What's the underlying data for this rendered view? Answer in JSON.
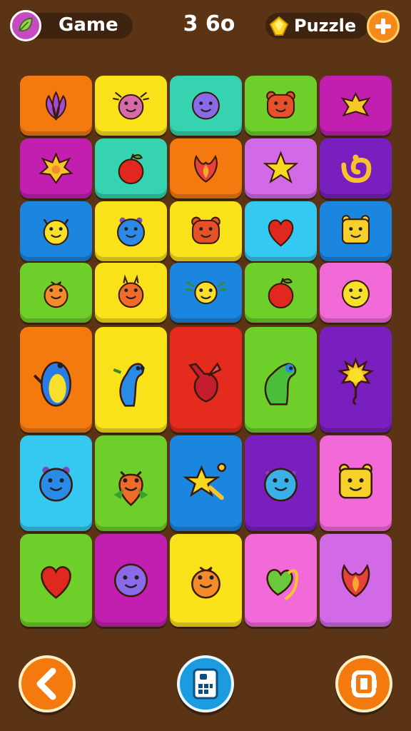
{
  "header": {
    "game_label": "Game",
    "score": "3 6o",
    "puzzle_label": "Puzzle"
  },
  "colors": {
    "background": "#5a3414",
    "orange": "#f47a10",
    "yellow": "#f9e21a",
    "teal": "#35d3b0",
    "green": "#6fcf2a",
    "magenta": "#c21fb0",
    "purple": "#7a1fbf",
    "blue": "#1b86e0",
    "cyan": "#35c8f0",
    "red": "#e52a1e",
    "pink": "#f26ad8",
    "lilac": "#d26ae8"
  },
  "board": {
    "rows": [
      [
        {
          "color": "orange",
          "icon": "lotus-icon"
        },
        {
          "color": "yellow",
          "icon": "bug-face-icon"
        },
        {
          "color": "teal",
          "icon": "purple-blob-icon"
        },
        {
          "color": "green",
          "icon": "bear-face-icon"
        },
        {
          "color": "magenta",
          "icon": "golden-bird-icon"
        }
      ],
      [
        {
          "color": "magenta",
          "icon": "sunflower-icon"
        },
        {
          "color": "teal",
          "icon": "apple-icon"
        },
        {
          "color": "orange",
          "icon": "flame-flower-icon"
        },
        {
          "color": "lilac",
          "icon": "star-icon"
        },
        {
          "color": "purple",
          "icon": "swirl-icon"
        }
      ],
      [
        {
          "color": "blue",
          "icon": "cat-face-icon"
        },
        {
          "color": "yellow",
          "icon": "blue-blob-icon"
        },
        {
          "color": "yellow",
          "icon": "bear-face-icon"
        },
        {
          "color": "cyan",
          "icon": "heart-icon"
        },
        {
          "color": "blue",
          "icon": "bear-square-icon"
        }
      ],
      [
        {
          "color": "green",
          "icon": "orange-fruit-icon"
        },
        {
          "color": "yellow",
          "icon": "horned-fruit-icon"
        },
        {
          "color": "blue",
          "icon": "winged-face-icon"
        },
        {
          "color": "green",
          "icon": "apple-icon"
        },
        {
          "color": "pink",
          "icon": "smiley-icon"
        }
      ],
      [
        {
          "color": "orange",
          "icon": "penguin-icon"
        },
        {
          "color": "yellow",
          "icon": "blue-worm-icon"
        },
        {
          "color": "red",
          "icon": "red-flower-icon"
        },
        {
          "color": "green",
          "icon": "green-worm-icon"
        },
        {
          "color": "purple",
          "icon": "bulb-flower-icon"
        }
      ],
      [
        {
          "color": "cyan",
          "icon": "blue-blob-icon"
        },
        {
          "color": "green",
          "icon": "orange-drop-icon"
        },
        {
          "color": "blue",
          "icon": "star-wand-icon"
        },
        {
          "color": "purple",
          "icon": "cat-blob-icon"
        },
        {
          "color": "pink",
          "icon": "bear-square-icon"
        }
      ],
      [
        {
          "color": "green",
          "icon": "heart-icon"
        },
        {
          "color": "magenta",
          "icon": "purple-blob-icon"
        },
        {
          "color": "yellow",
          "icon": "orange-fruit-icon"
        },
        {
          "color": "pink",
          "icon": "heart-swirl-icon"
        },
        {
          "color": "lilac",
          "icon": "flame-flower-icon"
        }
      ]
    ]
  },
  "controls": {
    "back_icon": "back-chevron-icon",
    "deck_icon": "card-deck-icon",
    "shuffle_icon": "shuffle-frame-icon"
  }
}
